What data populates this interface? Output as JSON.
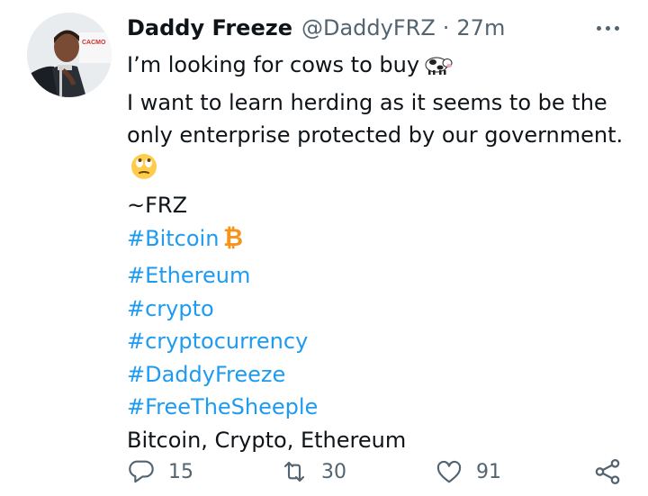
{
  "tweet": {
    "author_name": "Daddy Freeze",
    "handle": "@DaddyFRZ",
    "separator": "·",
    "time": "27m",
    "avatar_badge": "CACMO",
    "lines": [
      "I’m looking for cows to buy",
      "I want to learn herding as it seems to be the only enterprise protected by our government.",
      "~FRZ"
    ],
    "hashtags": [
      "#Bitcoin",
      "#Ethereum",
      "#crypto",
      "#cryptocurrency",
      "#DaddyFreeze",
      "#FreeTheSheeple"
    ],
    "footer_line": "Bitcoin, Crypto, Ethereum",
    "icons": {
      "cow": "cow-emoji",
      "eyeroll": "face-with-rolling-eyes-emoji",
      "bitcoin": "bitcoin-emoji",
      "more": "more-icon"
    }
  },
  "actions": {
    "reply_count": "15",
    "retweet_count": "30",
    "like_count": "91"
  },
  "colors": {
    "link": "#1d9bf0",
    "text": "#0f1419",
    "muted": "#536471",
    "bitcoin": "#f7931a"
  }
}
